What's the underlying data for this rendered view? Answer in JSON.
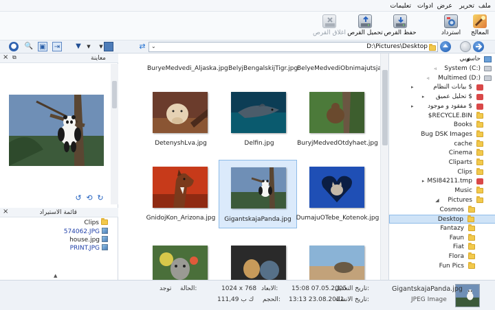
{
  "menu": [
    "ملف",
    "تحرير",
    "عرض",
    "ادوات",
    "تعليمات"
  ],
  "toolbar": {
    "wizard": "المعالج",
    "restore": "استرداد",
    "save_disk": "حفظ القرص",
    "load_disk": "تحميل القرص",
    "close_disk": "اغلاق القرص"
  },
  "address": {
    "path": "D:\\Pictures\\Desktop"
  },
  "preview": {
    "title": "معاينة"
  },
  "import_list": {
    "title": "قائمة الاستيراد",
    "items": [
      "Clips",
      "574062.JPG",
      "house.jpg",
      "PRINT.JPG"
    ]
  },
  "thumbnails": {
    "top_row": [
      "BuryeMedvedi_Aljaska.jpg",
      "BelyjBengalskijTigr.jpg",
      "BelyeMedvediObnimajutsja.jpg"
    ],
    "items": [
      {
        "name": "DetenyshLva.jpg"
      },
      {
        "name": "Delfin.jpg"
      },
      {
        "name": "BuryjMedvedOtdyhaet.jpg"
      },
      {
        "name": "GnidojKon_Arizona.jpg"
      },
      {
        "name": "GigantskajaPanda.jpg"
      },
      {
        "name": "DumajuOTebe_Kotenok.jpg"
      }
    ]
  },
  "tree": {
    "root": "حاسوبي",
    "items": [
      {
        "label": "System (C:)",
        "icon": "drive"
      },
      {
        "label": "Multimed (D:)",
        "icon": "drive"
      },
      {
        "label": "بيانات النظام $",
        "icon": "special"
      },
      {
        "label": "تحليل عميق $",
        "icon": "special"
      },
      {
        "label": "مفقود و موجود $",
        "icon": "special"
      },
      {
        "label": "$RECYCLE.BIN",
        "icon": "folder"
      },
      {
        "label": "Books",
        "icon": "folder"
      },
      {
        "label": "Bug DSK Images",
        "icon": "folder"
      },
      {
        "label": "cache",
        "icon": "folder"
      },
      {
        "label": "Cinema",
        "icon": "folder"
      },
      {
        "label": "Cliparts",
        "icon": "folder"
      },
      {
        "label": "Clips",
        "icon": "folder"
      },
      {
        "label": "MSI84211.tmp",
        "icon": "special"
      },
      {
        "label": "Music",
        "icon": "folder"
      },
      {
        "label": "Pictures",
        "icon": "folder"
      },
      {
        "label": "Cosmos",
        "icon": "folder"
      },
      {
        "label": "Desktop",
        "icon": "folder"
      },
      {
        "label": "Fantazy",
        "icon": "folder"
      },
      {
        "label": "Faun",
        "icon": "folder"
      },
      {
        "label": "Fiat",
        "icon": "folder"
      },
      {
        "label": "Flora",
        "icon": "folder"
      },
      {
        "label": "Fun Pics",
        "icon": "folder"
      }
    ]
  },
  "status": {
    "filename": "GigantskajaPanda.jpg",
    "filetype": "JPEG Image",
    "modified_label": "تاريخ التعديل:",
    "modified_value": "15:08 07.05.2005",
    "created_label": "تاريخ الانشاء:",
    "created_value": "13:13 23.08.2011",
    "dims_label": "الابعاد:",
    "dims_value": "1024 x 768",
    "size_label": "الحجم:",
    "size_value": "111,49 ك ب",
    "state_label": "الحالة:",
    "state_value": "توجد"
  }
}
